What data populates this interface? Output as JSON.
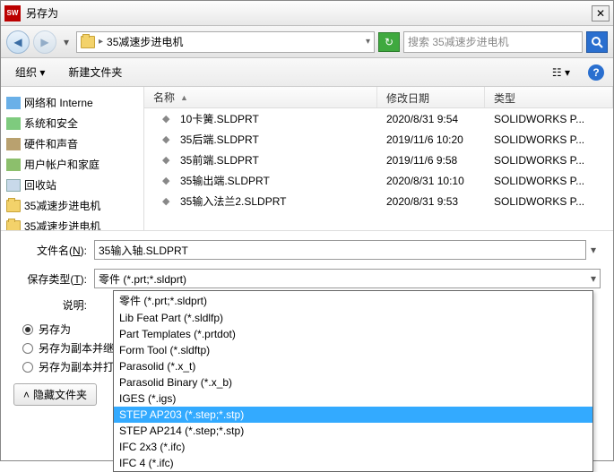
{
  "window": {
    "title": "另存为"
  },
  "nav": {
    "breadcrumb": "35减速步进电机",
    "search_placeholder": "搜索 35减速步进电机"
  },
  "toolbar": {
    "organize": "组织",
    "new_folder": "新建文件夹"
  },
  "tree": {
    "items": [
      {
        "label": "网络和 Interne",
        "cls": "ti-net"
      },
      {
        "label": "系统和安全",
        "cls": "ti-sys"
      },
      {
        "label": "硬件和声音",
        "cls": "ti-hw"
      },
      {
        "label": "用户帐户和家庭",
        "cls": "ti-user"
      },
      {
        "label": "回收站",
        "cls": "ti-bin"
      },
      {
        "label": "35减速步进电机",
        "cls": "folder-icon"
      },
      {
        "label": "35减速步进电机",
        "cls": "folder-icon"
      }
    ]
  },
  "columns": {
    "name": "名称",
    "date": "修改日期",
    "type": "类型"
  },
  "files": [
    {
      "name": "10卡簧.SLDPRT",
      "date": "2020/8/31 9:54",
      "type": "SOLIDWORKS P..."
    },
    {
      "name": "35后端.SLDPRT",
      "date": "2019/11/6 10:20",
      "type": "SOLIDWORKS P..."
    },
    {
      "name": "35前端.SLDPRT",
      "date": "2019/11/6 9:58",
      "type": "SOLIDWORKS P..."
    },
    {
      "name": "35输出端.SLDPRT",
      "date": "2020/8/31 10:10",
      "type": "SOLIDWORKS P..."
    },
    {
      "name": "35输入法兰2.SLDPRT",
      "date": "2020/8/31 9:53",
      "type": "SOLIDWORKS P..."
    }
  ],
  "form": {
    "filename_label_pre": "文件名(",
    "filename_hotkey": "N",
    "filename_label_post": "):",
    "filename_value": "35输入轴.SLDPRT",
    "savetype_label_pre": "保存类型(",
    "savetype_hotkey": "T",
    "savetype_label_post": "):",
    "savetype_value": "零件 (*.prt;*.sldprt)",
    "desc_label": "说明:",
    "radios": [
      {
        "label": "另存为",
        "checked": true
      },
      {
        "label": "另存为副本并继续",
        "checked": false
      },
      {
        "label": "另存为副本并打开",
        "checked": false
      }
    ],
    "hide_folders": "隐藏文件夹"
  },
  "dropdown": {
    "items": [
      "零件 (*.prt;*.sldprt)",
      "Lib Feat Part (*.sldlfp)",
      "Part Templates (*.prtdot)",
      "Form Tool (*.sldftp)",
      "Parasolid (*.x_t)",
      "Parasolid Binary (*.x_b)",
      "IGES (*.igs)",
      "STEP AP203 (*.step;*.stp)",
      "STEP AP214 (*.step;*.stp)",
      "IFC 2x3 (*.ifc)",
      "IFC 4 (*.ifc)"
    ],
    "selected_index": 7
  }
}
